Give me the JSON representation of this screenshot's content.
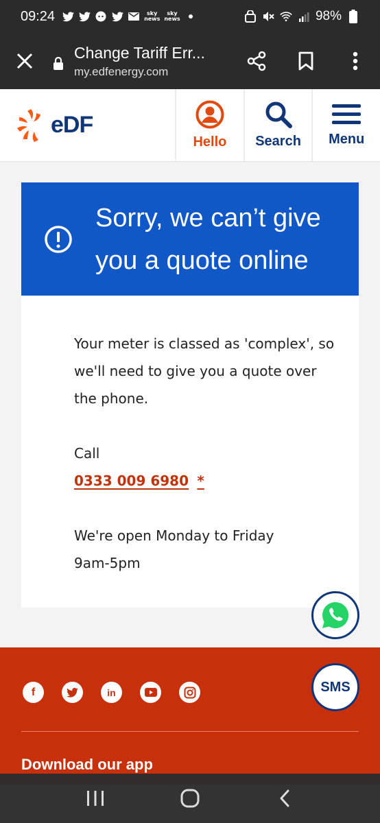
{
  "status_bar": {
    "time": "09:24",
    "notification_icons": [
      "twitter-icon",
      "twitter-icon",
      "reddit-icon",
      "twitter-icon",
      "mail-icon",
      "sky-news-icon",
      "sky-news-icon",
      "dot-icon"
    ],
    "sky_label": "sky",
    "sky_sub": "news",
    "battery": "98%"
  },
  "browser": {
    "title": "Change Tariff Err...",
    "url": "my.edfenergy.com"
  },
  "header": {
    "logo_text": "eDF",
    "nav": [
      {
        "label": "Hello",
        "color": "#e04a0f"
      },
      {
        "label": "Search",
        "color": "#10367a"
      },
      {
        "label": "Menu",
        "color": "#10367a"
      }
    ]
  },
  "alert": {
    "title": "Sorry, we can’t give you a quote online",
    "color": "#1057c8"
  },
  "body": {
    "paragraph1": "Your meter is classed as 'complex', so we'll need to give you a quote over the phone.",
    "call_label": "Call",
    "phone": "0333 009 6980",
    "asterisk": "*",
    "hours_line1": "We're open Monday to Friday",
    "hours_line2": "9am-5pm"
  },
  "floating": {
    "sms_label": "SMS"
  },
  "footer": {
    "color": "#c7300a",
    "social": [
      "facebook-icon",
      "twitter-icon",
      "linkedin-icon",
      "youtube-icon",
      "instagram-icon"
    ],
    "download_label": "Download our app"
  }
}
